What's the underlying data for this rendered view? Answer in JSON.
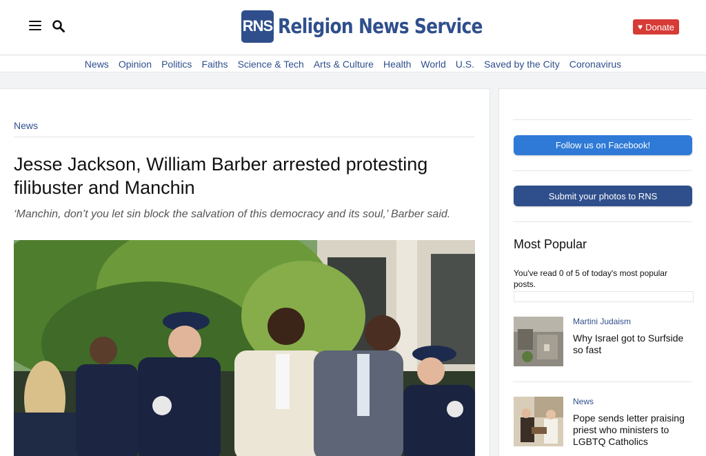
{
  "brand": {
    "logo_mark": "RNS",
    "name": "Religion News Service"
  },
  "header": {
    "donate_label": "Donate",
    "accent": "#2f4f8c",
    "donate_color": "#d63b36"
  },
  "nav": {
    "items": [
      "News",
      "Opinion",
      "Politics",
      "Faiths",
      "Science & Tech",
      "Arts & Culture",
      "Health",
      "World",
      "U.S.",
      "Saved by the City",
      "Coronavirus"
    ]
  },
  "article": {
    "category": "News",
    "headline": "Jesse Jackson, William Barber arrested protesting filibuster and Manchin",
    "subhead": "‘Manchin, don’t you let sin block the salvation of this democracy and its soul,’ Barber said."
  },
  "sidebar": {
    "facebook_label": "Follow us on Facebook!",
    "photos_label": "Submit your photos to RNS",
    "most_popular": {
      "title": "Most Popular",
      "note": "You've read 0 of 5 of today's most popular posts.",
      "items": [
        {
          "category": "Martini Judaism",
          "title": "Why Israel got to Surfside so fast"
        },
        {
          "category": "News",
          "title": "Pope sends letter praising priest who ministers to LGBTQ Catholics"
        }
      ]
    }
  }
}
